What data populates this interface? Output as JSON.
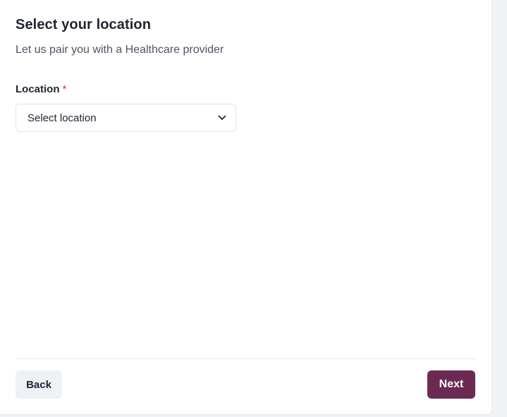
{
  "header": {
    "title": "Select your location",
    "subtitle": "Let us pair you with a Healthcare provider"
  },
  "form": {
    "location_label": "Location",
    "required_marker": "*",
    "location_select": {
      "selected_value": "Select location",
      "icon": "chevron-down-icon"
    }
  },
  "footer": {
    "back_label": "Back",
    "next_label": "Next"
  },
  "colors": {
    "primary": "#6b2a52",
    "required": "#e03131",
    "secondary_button_bg": "#eef1f5"
  }
}
